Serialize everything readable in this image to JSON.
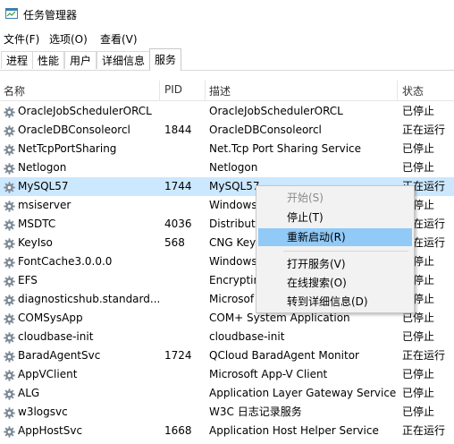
{
  "window": {
    "title": "任务管理器"
  },
  "menu": [
    "文件(F)",
    "选项(O)",
    "查看(V)"
  ],
  "tabs": [
    "进程",
    "性能",
    "用户",
    "详细信息",
    "服务"
  ],
  "active_tab": "服务",
  "columns": {
    "name": "名称",
    "pid": "PID",
    "desc": "描述",
    "status": "状态"
  },
  "services": [
    {
      "name": "OracleJobSchedulerORCL",
      "pid": "",
      "desc": "OracleJobSchedulerORCL",
      "status": "已停止"
    },
    {
      "name": "OracleDBConsoleorcl",
      "pid": "1844",
      "desc": "OracleDBConsoleorcl",
      "status": "正在运行"
    },
    {
      "name": "NetTcpPortSharing",
      "pid": "",
      "desc": "Net.Tcp Port Sharing Service",
      "status": "已停止"
    },
    {
      "name": "Netlogon",
      "pid": "",
      "desc": "Netlogon",
      "status": "已停止"
    },
    {
      "name": "MySQL57",
      "pid": "1744",
      "desc": "MySQL57",
      "status": "正在运行"
    },
    {
      "name": "msiserver",
      "pid": "",
      "desc": "Windows",
      "status": "已停止"
    },
    {
      "name": "MSDTC",
      "pid": "4036",
      "desc": "Distribute",
      "status": "正在运行"
    },
    {
      "name": "KeyIso",
      "pid": "568",
      "desc": "CNG Key",
      "status": "正在运行"
    },
    {
      "name": "FontCache3.0.0.0",
      "pid": "",
      "desc": "Windows",
      "status": "已停止"
    },
    {
      "name": "EFS",
      "pid": "",
      "desc": "Encryptin",
      "status": "已停止"
    },
    {
      "name": "diagnosticshub.standard...",
      "pid": "",
      "desc": "Microsof",
      "status": "已停止"
    },
    {
      "name": "COMSysApp",
      "pid": "",
      "desc": "COM+ System Application",
      "status": "已停止"
    },
    {
      "name": "cloudbase-init",
      "pid": "",
      "desc": "cloudbase-init",
      "status": "已停止"
    },
    {
      "name": "BaradAgentSvc",
      "pid": "1724",
      "desc": "QCloud BaradAgent Monitor",
      "status": "正在运行"
    },
    {
      "name": "AppVClient",
      "pid": "",
      "desc": "Microsoft App-V Client",
      "status": "已停止"
    },
    {
      "name": "ALG",
      "pid": "",
      "desc": "Application Layer Gateway Service",
      "status": "已停止"
    },
    {
      "name": "w3logsvc",
      "pid": "",
      "desc": "W3C 日志记录服务",
      "status": "已停止"
    },
    {
      "name": "AppHostSvc",
      "pid": "1668",
      "desc": "Application Host Helper Service",
      "status": "正在运行"
    }
  ],
  "selected_service": "MySQL57",
  "context_menu": {
    "start": "开始(S)",
    "stop": "停止(T)",
    "restart": "重新启动(R)",
    "open_services": "打开服务(V)",
    "search_online": "在线搜索(O)",
    "go_to_details": "转到详细信息(D)"
  },
  "context_menu_highlighted": "重新启动(R)",
  "icons": {
    "app": "task-manager-icon",
    "service": "gear-icon"
  },
  "colors": {
    "selection": "#cce8ff",
    "menu_hover": "#91c9f7",
    "menu_bg": "#f2f2f2"
  }
}
